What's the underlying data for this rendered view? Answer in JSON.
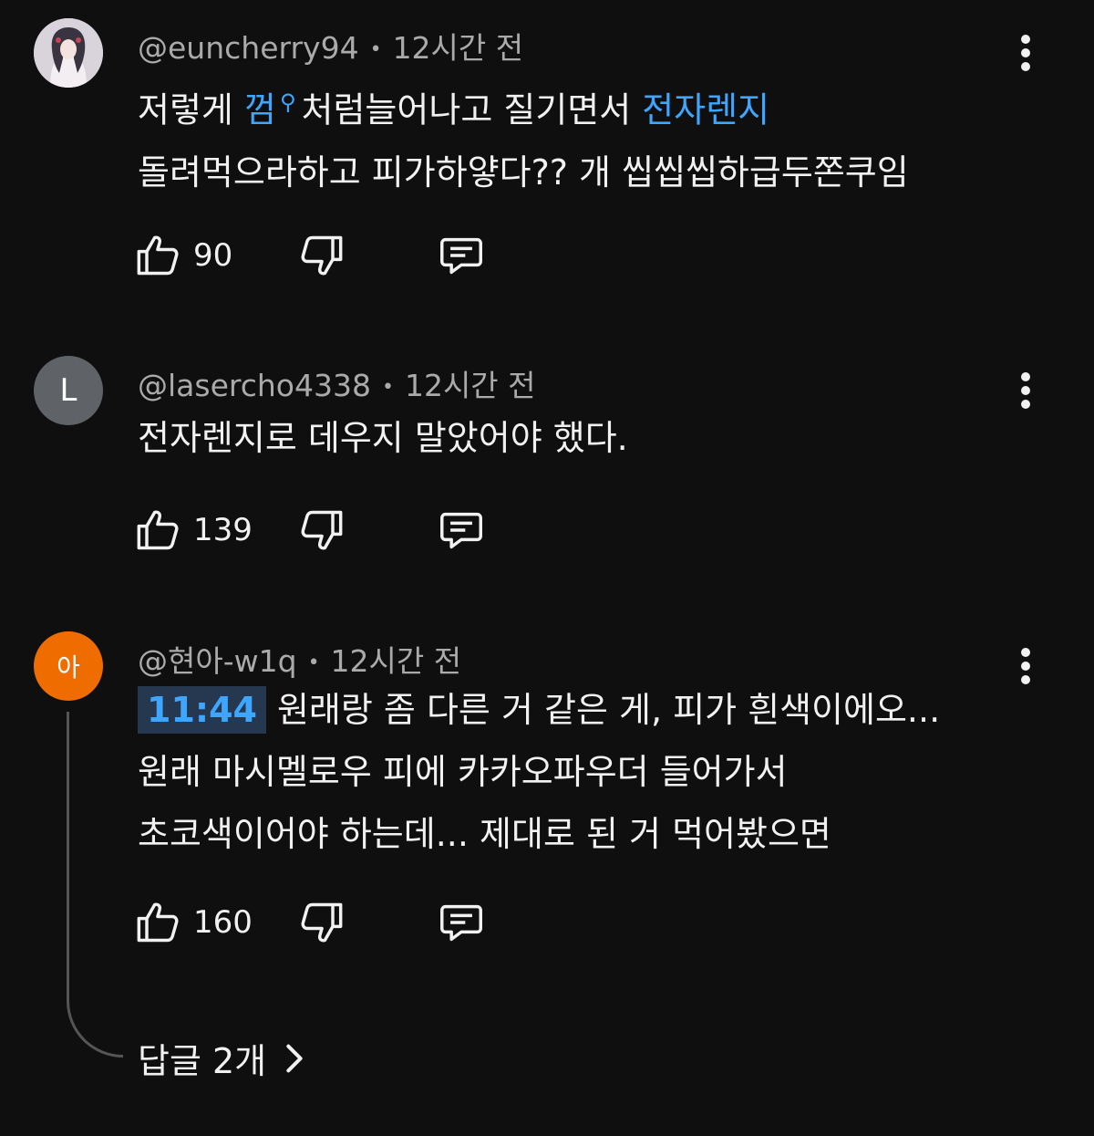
{
  "comments": [
    {
      "handle": "@euncherry94",
      "time": "12시간 전",
      "avatar": {
        "type": "photo",
        "icon": "profile-photo"
      },
      "lines": [
        {
          "parts": [
            {
              "text": "저렇게 "
            },
            {
              "text": "껌",
              "link": true
            },
            {
              "search_icon": "search-icon"
            },
            {
              "text": "처럼늘어나고 질기면서 "
            },
            {
              "text": "전자렌지",
              "link": true
            }
          ]
        },
        {
          "parts": [
            {
              "text": "돌려먹으라하고 피가하얗다?? 개 씹씹씹하급두쫀쿠임"
            }
          ]
        }
      ],
      "likes": "90"
    },
    {
      "handle": "@lasercho4338",
      "time": "12시간 전",
      "avatar": {
        "type": "letter",
        "letter": "L"
      },
      "lines": [
        {
          "parts": [
            {
              "text": "전자렌지로 데우지 말았어야 했다."
            }
          ]
        }
      ],
      "likes": "139"
    },
    {
      "handle": "@현아-w1q",
      "time": "12시간 전",
      "avatar": {
        "type": "letter",
        "letter": "아"
      },
      "timestamp_link": "11:44",
      "lines": [
        {
          "parts": [
            {
              "text": "원래랑 좀 다른 거 같은 게, 피가 흰색이에오..."
            }
          ]
        },
        {
          "parts": [
            {
              "text": "원래 마시멜로우 피에 카카오파우더 들어가서"
            }
          ]
        },
        {
          "parts": [
            {
              "text": "초코색이어야 하는데... 제대로 된 거 먹어봤으면"
            }
          ]
        }
      ],
      "likes": "160",
      "replies_label": "답글 2개"
    }
  ],
  "colors": {
    "background": "#0f0f0f",
    "text": "#f1f1f1",
    "meta": "#aaaaaa",
    "link": "#3ea6ff",
    "timestamp_bg": "#263850",
    "avatar_l": "#5f6368",
    "avatar_a": "#ef6c00"
  },
  "icons": {
    "like": "thumbs-up-icon",
    "dislike": "thumbs-down-icon",
    "reply": "reply-comment-icon",
    "more": "more-vert-icon",
    "expand": "chevron-right-icon"
  }
}
